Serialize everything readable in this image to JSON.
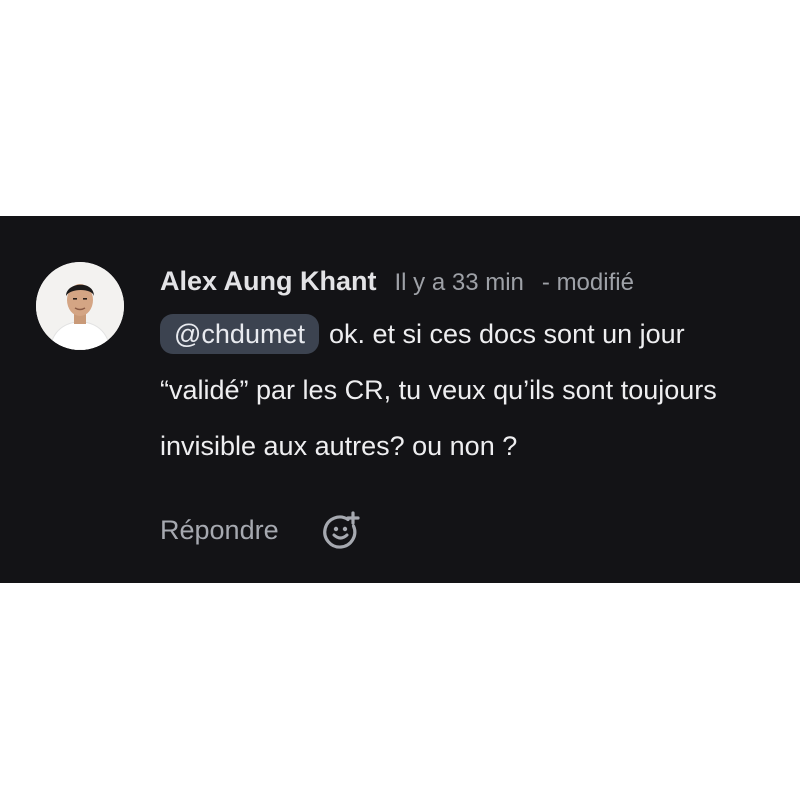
{
  "comment": {
    "author": "Alex Aung Khant",
    "timestamp": "Il y a 33 min",
    "edited": "- modifié",
    "mention": "@chdumet",
    "text": "ok. et si ces docs sont un jour “validé” par les CR, tu veux qu’ils sont toujours invisible aux autres? ou non ?"
  },
  "actions": {
    "reply_label": "Répondre",
    "reaction_icon": "add-emoji-icon"
  },
  "colors": {
    "card_background": "#131316",
    "page_background": "#ffffff",
    "mention_chip": "#3c4350",
    "muted_text": "#9ea1a7"
  }
}
